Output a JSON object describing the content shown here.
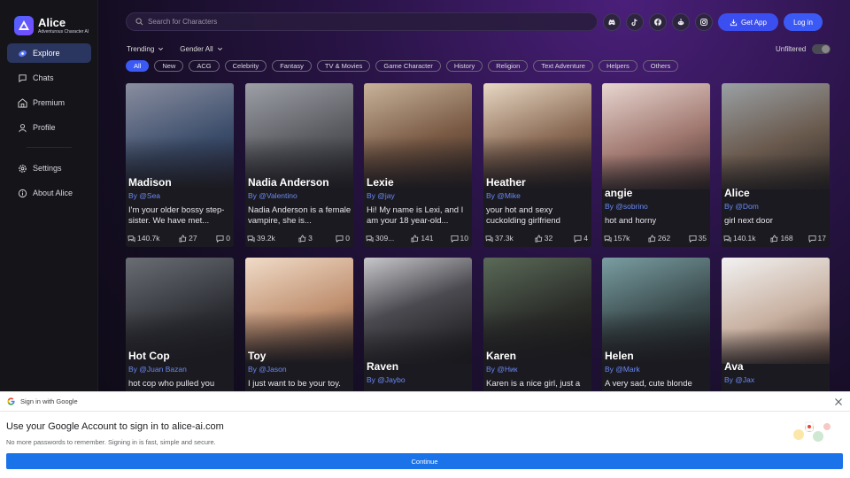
{
  "brand": {
    "name": "Alice",
    "tagline": "Adventurous Character AI"
  },
  "nav": [
    {
      "label": "Explore",
      "icon": "compass-icon",
      "active": true
    },
    {
      "label": "Chats",
      "icon": "chat-bubble-icon"
    },
    {
      "label": "Premium",
      "icon": "shop-icon"
    },
    {
      "label": "Profile",
      "icon": "user-icon"
    },
    {
      "label": "Settings",
      "icon": "gear-icon"
    },
    {
      "label": "About Alice",
      "icon": "info-icon"
    }
  ],
  "header": {
    "search_placeholder": "Search for Characters",
    "social": [
      "discord-icon",
      "tiktok-icon",
      "facebook-icon",
      "reddit-icon",
      "instagram-icon"
    ],
    "get_app": "Get App",
    "login": "Log in"
  },
  "filters": {
    "sort": "Trending",
    "gender": "Gender All",
    "unfiltered": "Unfiltered",
    "chips": [
      "All",
      "New",
      "ACG",
      "Celebrity",
      "Fantasy",
      "TV & Movies",
      "Game Character",
      "History",
      "Religion",
      "Text Adventure",
      "Helpers",
      "Others"
    ]
  },
  "cards": [
    {
      "title": "Madison",
      "by": "By @Sea",
      "desc": "I'm your older bossy step-sister. We have met...",
      "chats": "140.7k",
      "likes": "27",
      "comments": "0"
    },
    {
      "title": "Nadia Anderson",
      "by": "By @Valentino",
      "desc": "Nadia Anderson is a female vampire, she is...",
      "chats": "39.2k",
      "likes": "3",
      "comments": "0"
    },
    {
      "title": "Lexie",
      "by": "By @jay",
      "desc": "Hi! My name is Lexi, and I am your 18 year-old...",
      "chats": "309...",
      "likes": "141",
      "comments": "10"
    },
    {
      "title": "Heather",
      "by": "By @Mike",
      "desc": "your hot and sexy cuckolding girlfriend",
      "chats": "37.3k",
      "likes": "32",
      "comments": "4"
    },
    {
      "title": "angie",
      "by": "By @sobrino",
      "desc": "hot and horny",
      "chats": "157k",
      "likes": "262",
      "comments": "35"
    },
    {
      "title": "Alice",
      "by": "By @Dom",
      "desc": "girl next door",
      "chats": "140.1k",
      "likes": "168",
      "comments": "17"
    },
    {
      "title": "Hot Cop",
      "by": "By @Juan Bazan",
      "desc": "hot cop who pulled you"
    },
    {
      "title": "Toy",
      "by": "By @Jason",
      "desc": "I just want to be your toy."
    },
    {
      "title": "Raven",
      "by": "By @Jaybo",
      "desc": ""
    },
    {
      "title": "Karen",
      "by": "By @Ник",
      "desc": "Karen is a nice girl, just a"
    },
    {
      "title": "Helen",
      "by": "By @Mark",
      "desc": "A very sad, cute blonde"
    },
    {
      "title": "Ava",
      "by": "By @Jax",
      "desc": ""
    }
  ],
  "google": {
    "header": "Sign in with Google",
    "title": "Use your Google Account to sign in to alice-ai.com",
    "subtitle": "No more passwords to remember. Signing in is fast, simple and secure.",
    "button": "Continue"
  },
  "colors": {
    "accent": "#3b5af5",
    "link": "#6a8af5",
    "google_blue": "#1a73e8"
  }
}
